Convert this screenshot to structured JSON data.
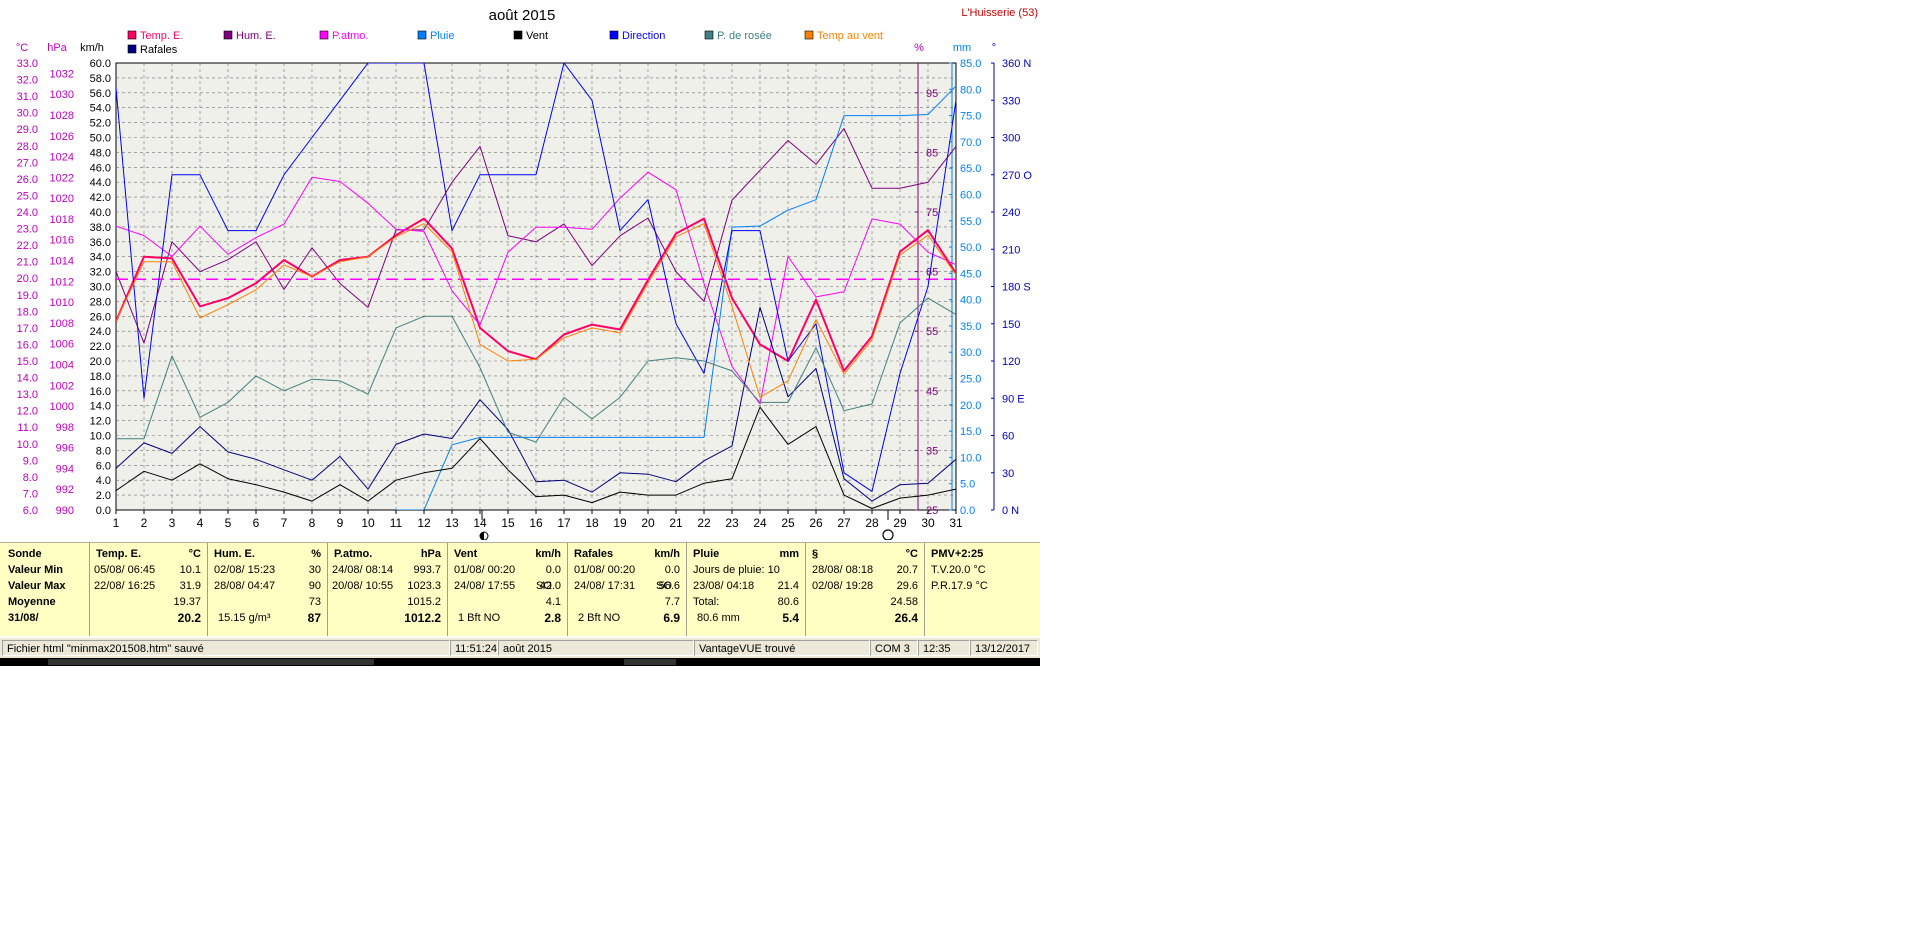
{
  "title": "août 2015",
  "station": "L'Huisserie (53)",
  "units_left": [
    "°C",
    "hPa",
    "km/h"
  ],
  "units_right": [
    "%",
    "mm",
    "°"
  ],
  "legend": [
    {
      "label": "Temp. E.",
      "color": "#ff0066"
    },
    {
      "label": "Hum. E.",
      "color": "#800080"
    },
    {
      "label": "P.atmo.",
      "color": "#ff00ff"
    },
    {
      "label": "Pluie",
      "color": "#0080ff"
    },
    {
      "label": "Vent",
      "color": "#000000"
    },
    {
      "label": "Direction",
      "color": "#0000ff"
    },
    {
      "label": "P. de rosée",
      "color": "#408080"
    },
    {
      "label": "Temp au vent",
      "color": "#ff8000"
    },
    {
      "label": "Rafales",
      "color": "#000080"
    }
  ],
  "chart_data": {
    "type": "line",
    "title": "août 2015",
    "x": [
      1,
      2,
      3,
      4,
      5,
      6,
      7,
      8,
      9,
      10,
      11,
      12,
      13,
      14,
      15,
      16,
      17,
      18,
      19,
      20,
      21,
      22,
      23,
      24,
      25,
      26,
      27,
      28,
      29,
      30,
      31
    ],
    "axes": {
      "temp_c": {
        "range": [
          6.0,
          33.0
        ],
        "ticks": [
          "6.0",
          "7.0",
          "8.0",
          "9.0",
          "10.0",
          "11.0",
          "12.0",
          "13.0",
          "14.0",
          "15.0",
          "16.0",
          "17.0",
          "18.0",
          "19.0",
          "20.0",
          "21.0",
          "22.0",
          "23.0",
          "24.0",
          "25.0",
          "26.0",
          "27.0",
          "28.0",
          "29.0",
          "30.0",
          "31.0",
          "32.0",
          "33.0"
        ]
      },
      "pressure_hpa": {
        "range": [
          990,
          1033
        ],
        "ticks": [
          "990",
          "992",
          "994",
          "996",
          "998",
          "1000",
          "1002",
          "1004",
          "1006",
          "1008",
          "1010",
          "1012",
          "1014",
          "1016",
          "1018",
          "1020",
          "1022",
          "1024",
          "1026",
          "1028",
          "1030",
          "1032"
        ]
      },
      "wind_kmh": {
        "range": [
          0.0,
          60.0
        ],
        "ticks": [
          "0.0",
          "2.0",
          "4.0",
          "6.0",
          "8.0",
          "10.0",
          "12.0",
          "14.0",
          "16.0",
          "18.0",
          "20.0",
          "22.0",
          "24.0",
          "26.0",
          "28.0",
          "30.0",
          "32.0",
          "34.0",
          "36.0",
          "38.0",
          "40.0",
          "42.0",
          "44.0",
          "46.0",
          "48.0",
          "50.0",
          "52.0",
          "54.0",
          "56.0",
          "58.0",
          "60.0"
        ]
      },
      "humidity_pct": {
        "range": [
          25,
          100
        ],
        "ticks": [
          "25",
          "35",
          "45",
          "55",
          "65",
          "75",
          "85",
          "95"
        ]
      },
      "rain_mm": {
        "range": [
          0.0,
          85.0
        ],
        "ticks": [
          "0.0",
          "5.0",
          "10.0",
          "15.0",
          "20.0",
          "25.0",
          "30.0",
          "35.0",
          "40.0",
          "45.0",
          "50.0",
          "55.0",
          "60.0",
          "65.0",
          "70.0",
          "75.0",
          "80.0",
          "85.0"
        ]
      },
      "direction_deg": {
        "range": [
          0,
          360
        ],
        "ticks": [
          "0  N",
          "30",
          "60",
          "90  E",
          "120",
          "150",
          "180 S",
          "210",
          "240",
          "270 O",
          "300",
          "330",
          "360 N"
        ]
      }
    },
    "series": [
      {
        "name": "Temp. E.",
        "axis": "temp_c",
        "color": "#ff0066",
        "width": 2,
        "values": [
          17.4,
          21.3,
          21.2,
          18.3,
          18.8,
          19.7,
          21.1,
          20.1,
          21.1,
          21.3,
          22.6,
          23.6,
          21.8,
          17.0,
          15.6,
          15.1,
          16.6,
          17.2,
          16.9,
          19.9,
          22.7,
          23.6,
          18.8,
          16.0,
          15.0,
          18.7,
          14.4,
          16.5,
          21.6,
          22.9,
          20.3
        ]
      },
      {
        "name": "Hum. E.",
        "axis": "humidity_pct",
        "color": "#800080",
        "width": 1,
        "values": [
          65,
          53,
          70,
          65,
          67,
          70,
          62,
          69,
          63,
          59,
          72,
          72,
          80,
          86,
          71,
          70,
          73,
          66,
          71,
          74,
          65,
          60,
          77,
          82,
          87,
          83,
          89,
          79,
          79,
          80,
          86
        ]
      },
      {
        "name": "P.atmo.",
        "axis": "pressure_hpa",
        "color": "#ff00ff",
        "width": 1,
        "values": [
          1017.3,
          1016.4,
          1014.4,
          1017.3,
          1014.6,
          1016.2,
          1017.5,
          1022.0,
          1021.6,
          1019.5,
          1017.0,
          1016.8,
          1011.1,
          1007.8,
          1014.8,
          1017.2,
          1017.2,
          1017.0,
          1020.0,
          1022.5,
          1020.8,
          1011.8,
          1003.8,
          1000.2,
          1014.4,
          1010.5,
          1011.0,
          1018.0,
          1017.5,
          1014.8,
          1013.6
        ]
      },
      {
        "name": "P.atmo. moyenne",
        "axis": "pressure_hpa",
        "color": "#ff00ff",
        "width": 1,
        "dashed": true,
        "values": [
          1012.2,
          1012.2,
          1012.2,
          1012.2,
          1012.2,
          1012.2,
          1012.2,
          1012.2,
          1012.2,
          1012.2,
          1012.2,
          1012.2,
          1012.2,
          1012.2,
          1012.2,
          1012.2,
          1012.2,
          1012.2,
          1012.2,
          1012.2,
          1012.2,
          1012.2,
          1012.2,
          1012.2,
          1012.2,
          1012.2,
          1012.2,
          1012.2,
          1012.2,
          1012.2,
          1012.2
        ]
      },
      {
        "name": "Pluie",
        "axis": "rain_mm",
        "color": "#0080ff",
        "width": 1,
        "values": [
          null,
          null,
          null,
          null,
          null,
          null,
          null,
          null,
          null,
          null,
          0,
          0,
          12.4,
          13.8,
          13.8,
          13.8,
          13.8,
          13.8,
          13.8,
          13.8,
          13.8,
          13.8,
          53.8,
          54.0,
          57.0,
          59.0,
          75.0,
          75.0,
          75.0,
          75.2,
          80.6
        ]
      },
      {
        "name": "Vent",
        "axis": "wind_kmh",
        "color": "#000000",
        "width": 1,
        "values": [
          2.6,
          5.2,
          4.0,
          6.2,
          4.2,
          3.4,
          2.4,
          1.2,
          3.4,
          1.2,
          4.0,
          5.0,
          5.6,
          9.6,
          5.4,
          1.8,
          2.0,
          1.0,
          2.4,
          2.0,
          2.0,
          3.6,
          4.2,
          13.8,
          8.8,
          11.2,
          2.0,
          0.2,
          1.6,
          2.0,
          2.8
        ]
      },
      {
        "name": "Rafales",
        "axis": "wind_kmh",
        "color": "#000080",
        "width": 1,
        "values": [
          5.6,
          9.0,
          7.6,
          11.2,
          7.8,
          6.8,
          5.4,
          4.0,
          7.2,
          2.8,
          8.8,
          10.2,
          9.6,
          14.8,
          10.8,
          3.8,
          4.0,
          2.4,
          5.0,
          4.8,
          3.8,
          6.6,
          8.6,
          27.2,
          15.2,
          19.0,
          4.2,
          1.2,
          3.4,
          3.6,
          6.8
        ]
      },
      {
        "name": "Direction",
        "axis": "direction_deg",
        "color": "#0000ff",
        "width": 1,
        "values": [
          340,
          90,
          270,
          270,
          225,
          225,
          270,
          300,
          330,
          360,
          360,
          360,
          225,
          270,
          270,
          270,
          360,
          330,
          225,
          250,
          150,
          110,
          225,
          225,
          120,
          150,
          30,
          15,
          110,
          180,
          330
        ]
      },
      {
        "name": "P. de rosée",
        "axis": "temp_c",
        "color": "#408080",
        "width": 1,
        "values": [
          10.3,
          10.3,
          15.3,
          11.6,
          12.5,
          14.1,
          13.2,
          13.9,
          13.8,
          13.0,
          17.0,
          17.7,
          17.7,
          14.6,
          10.7,
          10.1,
          12.8,
          11.5,
          12.8,
          15.0,
          15.2,
          15.0,
          14.4,
          12.5,
          12.5,
          15.8,
          12.0,
          12.4,
          17.3,
          18.8,
          17.8
        ]
      },
      {
        "name": "Temp au vent",
        "axis": "temp_c",
        "color": "#ff8000",
        "width": 1,
        "values": [
          17.4,
          21.0,
          21.0,
          17.6,
          18.4,
          19.3,
          20.8,
          20.1,
          21.0,
          21.3,
          22.5,
          23.3,
          21.6,
          16.0,
          15.0,
          15.1,
          16.4,
          17.0,
          16.7,
          19.7,
          22.5,
          23.3,
          18.3,
          12.8,
          13.8,
          17.5,
          14.2,
          16.3,
          21.4,
          22.6,
          20.2
        ]
      }
    ],
    "grid": true,
    "legend_placement": "top"
  },
  "stats": {
    "sonde": {
      "header": "Sonde",
      "rows": [
        "Valeur Min",
        "Valeur Max",
        "Moyenne",
        "31/08/"
      ]
    },
    "temp": {
      "header": "Temp. E.",
      "unit": "°C",
      "min_time": "05/08/  06:45",
      "min_val": "10.1",
      "max_time": "22/08/  16:25",
      "max_val": "31.9",
      "avg": "19.37",
      "last": "20.2"
    },
    "hum": {
      "header": "Hum. E.",
      "unit": "%",
      "min_time": "02/08/  15:23",
      "min_val": "30",
      "max_time": "28/08/  04:47",
      "max_val": "90",
      "avg": "73",
      "extra": "15.15 g/m³",
      "last": "87"
    },
    "patmo": {
      "header": "P.atmo.",
      "unit": "hPa",
      "min_time": "24/08/  08:14",
      "min_val": "993.7",
      "max_time": "20/08/  10:55",
      "max_val": "1023.3",
      "avg": "1015.2",
      "last": "1012.2"
    },
    "vent": {
      "header": "Vent",
      "unit": "km/h",
      "min_time": "01/08/  00:20",
      "min_val": "0.0",
      "max_time": "24/08/  17:55",
      "max_dir": "SO",
      "max_val": "42.0",
      "avg": "4.1",
      "extra": "1 Bft NO",
      "last": "2.8"
    },
    "rafales": {
      "header": "Rafales",
      "unit": "km/h",
      "min_time": "01/08/  00:20",
      "min_val": "0.0",
      "max_time": "24/08/  17:31",
      "max_dir": "SO",
      "max_val": "56.6",
      "avg": "7.7",
      "extra": "2 Bft NO",
      "last": "6.9"
    },
    "pluie": {
      "header": "Pluie",
      "unit": "mm",
      "row1": "Jours de pluie: 10",
      "max_time": "23/08/  04:18",
      "max_val": "21.4",
      "total_label": "Total:",
      "total": "80.6",
      "extra": "80.6 mm",
      "last": "5.4"
    },
    "s": {
      "header": "§",
      "unit": "°C",
      "min_time": "28/08/  08:18",
      "min_val": "20.7",
      "max_time": "02/08/  19:28",
      "max_val": "29.6",
      "avg": "24.58",
      "last": "26.4"
    },
    "pmv": {
      "header": "PMV+2:25",
      "line1": "T.V.20.0 °C",
      "line2": "P.R.17.9 °C"
    }
  },
  "statusbar": {
    "file": "Fichier html  \"minmax201508.htm\"  sauvé",
    "time": "11:51:24",
    "month": "août 2015",
    "device": "VantageVUE trouvé",
    "port": "COM 3",
    "clock": "12:35",
    "date": "13/12/2017"
  }
}
